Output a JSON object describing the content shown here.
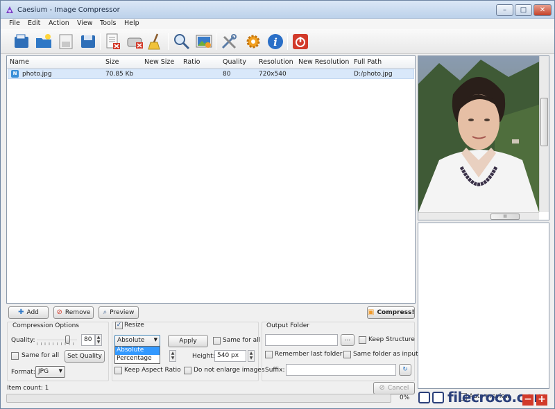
{
  "window": {
    "title": "Caesium - Image Compressor",
    "controls": {
      "minimize": "–",
      "maximize": "□",
      "close": "✕"
    }
  },
  "menu": [
    "File",
    "Edit",
    "Action",
    "View",
    "Tools",
    "Help"
  ],
  "toolbar": {
    "icons": [
      "open-files-icon",
      "open-folder-icon",
      "save-list-icon",
      "save-icon",
      "remove-item-icon",
      "clear-list-icon",
      "clean-icon",
      "zoom-icon",
      "preview-image-icon",
      "settings-tools-icon",
      "options-gear-icon",
      "about-info-icon",
      "exit-power-icon"
    ]
  },
  "file_list": {
    "columns": [
      "Name",
      "Size",
      "New Size",
      "Ratio",
      "Quality",
      "Resolution",
      "New Resolution",
      "Full Path"
    ],
    "rows": [
      {
        "icon": "N",
        "name": "photo.jpg",
        "size": "70.85 Kb",
        "new_size": "",
        "ratio": "",
        "quality": "80",
        "resolution": "720x540",
        "new_resolution": "",
        "full_path": "D:/photo.jpg"
      }
    ]
  },
  "preview": {
    "hscroll_label": "III"
  },
  "actions": {
    "add": "Add",
    "remove": "Remove",
    "preview": "Preview",
    "compress": "Compress!"
  },
  "compression": {
    "title": "Compression Options",
    "quality_label": "Quality:",
    "quality_value": "80",
    "quality_fraction": 0.8,
    "same_for_all": "Same for all",
    "set_quality": "Set Quality",
    "format_label": "Format:",
    "format_value": "JPG"
  },
  "resize": {
    "enabled_label": "Resize",
    "mode_value": "Absolute",
    "mode_options": [
      "Absolute",
      "Percentage"
    ],
    "apply": "Apply",
    "same_for_all": "Same for all",
    "height_label": "Height:",
    "height_value": "540 px",
    "keep_aspect": "Keep Aspect Ratio",
    "no_enlarge": "Do not enlarge images"
  },
  "output": {
    "title": "Output Folder",
    "path_value": "",
    "browse": "...",
    "keep_structure": "Keep Structure",
    "remember_last": "Remember last folder",
    "same_as_input": "Same folder as input",
    "suffix_label": "Suffix:",
    "suffix_value": ""
  },
  "status": {
    "item_count": "Item count: 1",
    "cancel": "Cancel",
    "progress_text": "0%",
    "progress_fraction": 0,
    "auto_preview": "Auto preview"
  },
  "watermark": {
    "text": "filecroco.com"
  },
  "colors": {
    "accent": "#3a8fd8",
    "selection": "#3399ff",
    "danger": "#d23a2a"
  }
}
